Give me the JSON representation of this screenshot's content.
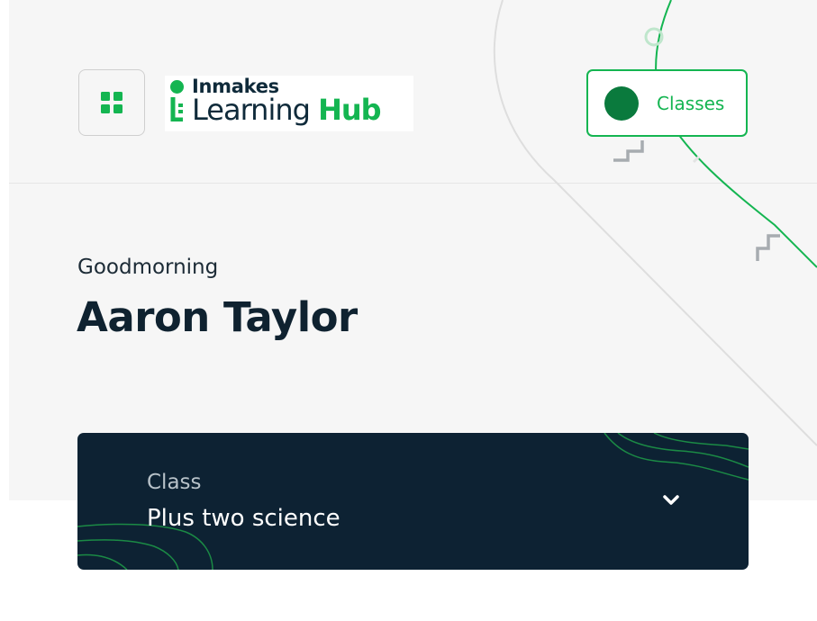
{
  "header": {
    "logo": {
      "brand_top": "Inmakes",
      "brand_word": "Learning",
      "brand_accent": "Hub"
    },
    "classes_button": {
      "label": "Classes"
    },
    "menu_icon": "grid-icon"
  },
  "main": {
    "greeting": "Goodmorning",
    "user_name": "Aaron Taylor",
    "class_selector": {
      "caption": "Class",
      "selected": "Plus two science",
      "icon": "chevron-down-icon"
    }
  },
  "colors": {
    "accent": "#14b551",
    "accent_dark": "#0a7a3d",
    "navy": "#0d2233",
    "background": "#f6f6f6"
  }
}
